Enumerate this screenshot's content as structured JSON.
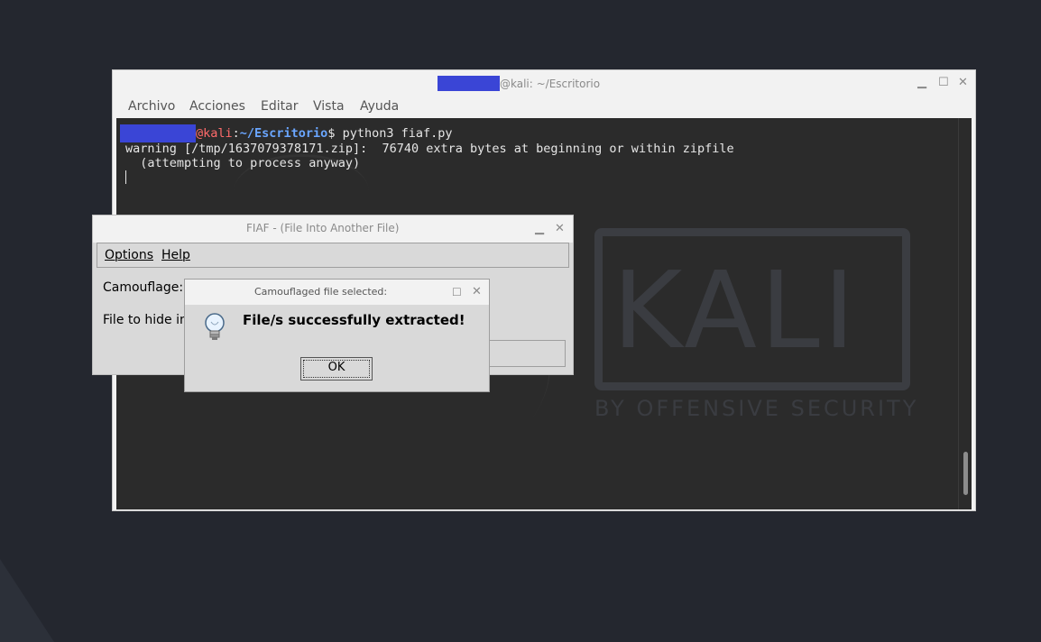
{
  "terminal": {
    "title_suffix": "@kali: ~/Escritorio",
    "menu": [
      "Archivo",
      "Acciones",
      "Editar",
      "Vista",
      "Ayuda"
    ],
    "prompt_host": "@kali",
    "prompt_sep": ":",
    "prompt_path": "~/Escritorio",
    "prompt_symbol": "$",
    "command": " python3 fiaf.py",
    "output_line1": "warning [/tmp/1637079378171.zip]:  76740 extra bytes at beginning or within zipfile",
    "output_line2": "  (attempting to process anyway)",
    "bg_logo": "KALI",
    "bg_logo_sub": "BY OFFENSIVE SECURITY"
  },
  "fiaf": {
    "title": "FIAF - (File Into Another File)",
    "menu": [
      "Options",
      "Help"
    ],
    "camouflage_label": "Camouflage:",
    "file_to_hide_label": "File to hide in"
  },
  "dialog": {
    "title": "Camouflaged file selected:",
    "message": "File/s successfully extracted!",
    "ok_label": "OK",
    "icon": "lightbulb-icon"
  },
  "colors": {
    "desktop_bg": "#24272f",
    "terminal_bg": "#2b2b2b",
    "prompt_user": "#ff6b6b",
    "prompt_path": "#6aa6ff",
    "redaction": "#3a45d6"
  }
}
